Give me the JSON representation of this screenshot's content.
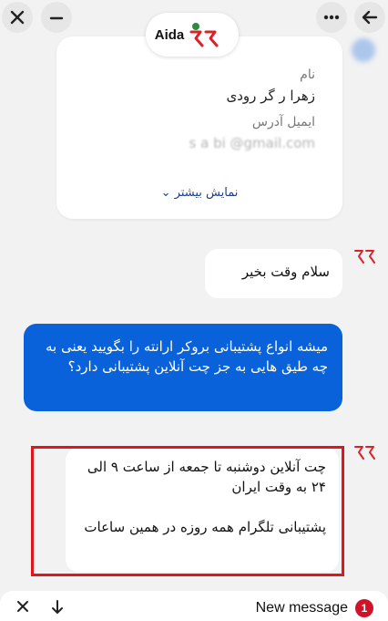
{
  "header": {
    "close_icon": "close-icon",
    "minimize_icon": "minimize-icon",
    "more_icon": "more-icon",
    "back_icon": "arrow-left-icon",
    "brand_name": "Aida"
  },
  "contact_card": {
    "name_label": "نام",
    "name_value": "زهرا ر     گر رودی",
    "email_label": "ایمیل آدرس",
    "email_value": "s     a      bi  @gmail.com",
    "show_more": "نمایش بیشتر"
  },
  "messages": [
    {
      "sender": "bot",
      "text": "سلام وقت بخیر"
    },
    {
      "sender": "user",
      "text": "میشه انواع پشتیبانی بروکر ارانته را بگویید یعنی به چه طیق هایی به جز چت آنلاین پشتیبانی دارد؟"
    },
    {
      "sender": "bot",
      "line1": "چت آنلاین دوشنبه تا جمعه از ساعت ۹ الی ۲۴ به وقت ایران",
      "line2": "پشتیبانی تلگرام همه روزه در همین ساعات"
    }
  ],
  "composer": {
    "new_message_label": "New message",
    "unread_count": "1"
  },
  "colors": {
    "user_bubble": "#0a62da",
    "highlight": "#e0161e",
    "badge": "#d1132a",
    "logo_red": "#d8232a",
    "logo_green": "#2e8b3e"
  }
}
